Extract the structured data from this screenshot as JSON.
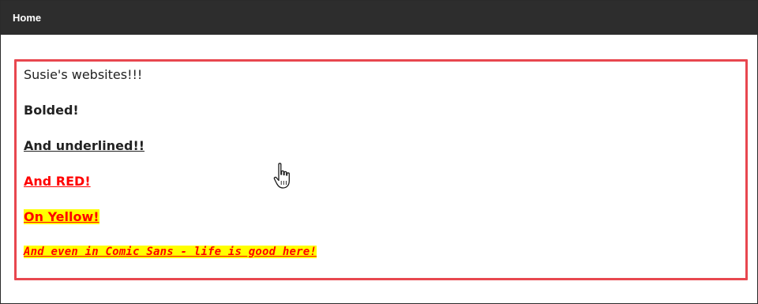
{
  "navbar": {
    "home_label": "Home"
  },
  "content": {
    "line1": "Susie's websites!!!",
    "line2": "Bolded!",
    "line3": "And underlined!!",
    "line4": "And RED!",
    "line5": "On Yellow!",
    "line6": "And even in Comic Sans - life is good here!"
  },
  "colors": {
    "navbar_bg": "#2d2d2d",
    "box_border": "#e8474f",
    "red_text": "#ff0000",
    "yellow_bg": "#ffff00"
  },
  "icons": {
    "cursor": "hand-pointer-cursor-icon"
  }
}
